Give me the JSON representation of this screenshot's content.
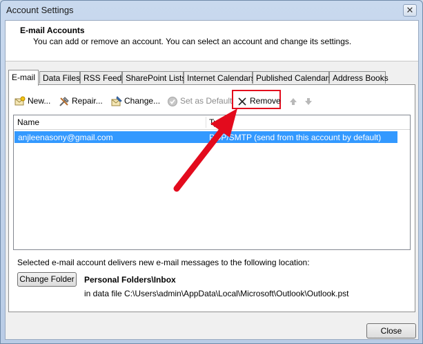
{
  "window": {
    "title": "Account Settings",
    "close_glyph": "✕"
  },
  "header": {
    "title": "E-mail Accounts",
    "description": "You can add or remove an account. You can select an account and change its settings."
  },
  "tabs": [
    {
      "label": "E-mail",
      "active": true
    },
    {
      "label": "Data Files"
    },
    {
      "label": "RSS Feeds"
    },
    {
      "label": "SharePoint Lists"
    },
    {
      "label": "Internet Calendars"
    },
    {
      "label": "Published Calendars"
    },
    {
      "label": "Address Books"
    }
  ],
  "toolbar": {
    "new_label": "New...",
    "repair_label": "Repair...",
    "change_label": "Change...",
    "set_default_label": "Set as Default",
    "remove_label": "Remove"
  },
  "list": {
    "columns": [
      "Name",
      "Type"
    ],
    "rows": [
      {
        "name": "anjleenasony@gmail.com",
        "type": "POP/SMTP (send from this account by default)",
        "selected": true
      }
    ]
  },
  "footer": {
    "deliver_text": "Selected e-mail account delivers new e-mail messages to the following location:",
    "change_folder_label": "Change Folder",
    "folder_name": "Personal Folders\\Inbox",
    "data_file_text": "in data file C:\\Users\\admin\\AppData\\Local\\Microsoft\\Outlook\\Outlook.pst"
  },
  "close_label": "Close",
  "colors": {
    "selection": "#3399ff",
    "annotation_red": "#e30b1d"
  },
  "icons": [
    "new-account-icon",
    "repair-icon",
    "change-icon",
    "set-default-icon",
    "remove-x-icon",
    "move-up-icon",
    "move-down-icon"
  ]
}
